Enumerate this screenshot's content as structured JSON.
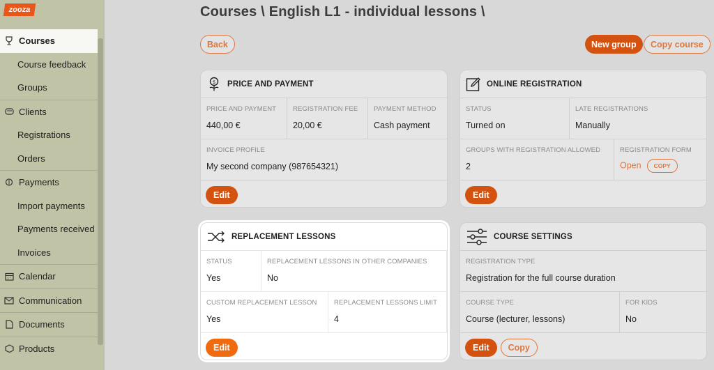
{
  "app": {
    "logo_text": "zooza"
  },
  "sidebar": {
    "items": [
      {
        "label": "Courses",
        "icon": "trophy-icon",
        "top": true,
        "active": true
      },
      {
        "label": "Course feedback"
      },
      {
        "label": "Groups"
      },
      {
        "label": "Clients",
        "icon": "clients-icon",
        "top": true
      },
      {
        "label": "Registrations"
      },
      {
        "label": "Orders"
      },
      {
        "label": "Payments",
        "icon": "payments-icon",
        "top": true
      },
      {
        "label": "Import payments"
      },
      {
        "label": "Payments received"
      },
      {
        "label": "Invoices"
      },
      {
        "label": "Calendar",
        "icon": "calendar-icon",
        "top": true
      },
      {
        "label": "Communication",
        "icon": "mail-icon",
        "top": true
      },
      {
        "label": "Documents",
        "icon": "document-icon",
        "top": true
      },
      {
        "label": "Products",
        "icon": "products-icon",
        "top": true
      }
    ]
  },
  "header": {
    "title": "Courses \\ English L1 - individual lessons \\"
  },
  "actions": {
    "back": "Back",
    "new_group": "New group",
    "copy_course": "Copy course"
  },
  "price_card": {
    "title": "PRICE AND PAYMENT",
    "price_label": "PRICE AND PAYMENT",
    "price_value": "440,00 €",
    "fee_label": "REGISTRATION FEE",
    "fee_value": "20,00 €",
    "method_label": "PAYMENT METHOD",
    "method_value": "Cash payment",
    "invoice_label": "INVOICE PROFILE",
    "invoice_value": "My second company (987654321)",
    "edit": "Edit"
  },
  "online_card": {
    "title": "ONLINE REGISTRATION",
    "status_label": "STATUS",
    "status_value": "Turned on",
    "late_label": "LATE REGISTRATIONS",
    "late_value": "Manually",
    "groups_label": "GROUPS WITH REGISTRATION ALLOWED",
    "groups_value": "2",
    "form_label": "REGISTRATION FORM",
    "form_value": "Open",
    "form_copy": "COPY",
    "edit": "Edit"
  },
  "replacement_card": {
    "title": "REPLACEMENT LESSONS",
    "status_label": "STATUS",
    "status_value": "Yes",
    "other_label": "REPLACEMENT LESSONS IN OTHER COMPANIES",
    "other_value": "No",
    "custom_label": "CUSTOM REPLACEMENT LESSON",
    "custom_value": "Yes",
    "limit_label": "REPLACEMENT LESSONS LIMIT",
    "limit_value": "4",
    "edit": "Edit"
  },
  "settings_card": {
    "title": "COURSE SETTINGS",
    "regtype_label": "REGISTRATION TYPE",
    "regtype_value": "Registration for the full course duration",
    "type_label": "COURSE TYPE",
    "type_value": "Course (lecturer, lessons)",
    "kids_label": "FOR KIDS",
    "kids_value": "No",
    "edit": "Edit",
    "copy": "Copy"
  },
  "colors": {
    "accent": "#d4520f",
    "accent_light": "#e0763f",
    "sidebar": "#c0c3a6"
  }
}
